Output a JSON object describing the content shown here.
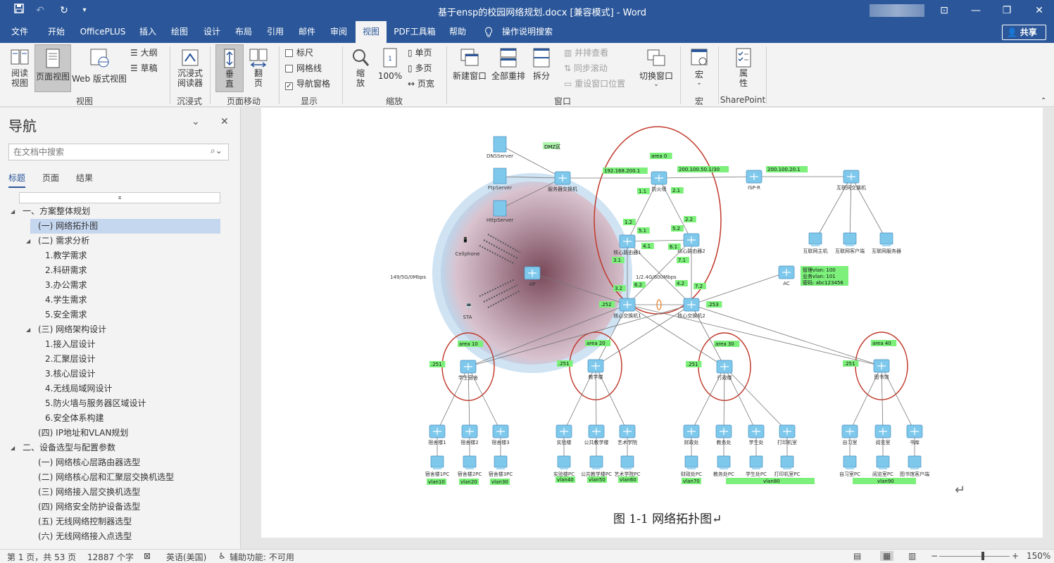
{
  "window": {
    "title": "基于ensp的校园网络规划.docx [兼容模式]  -  Word",
    "controls": {
      "ribbon_display": "⊡",
      "minimize": "—",
      "restore": "❐",
      "close": "✕"
    }
  },
  "quick_access": {
    "save": "💾",
    "undo": "↶",
    "redo": "↻",
    "customize": "▾"
  },
  "menu": {
    "tabs": [
      "文件",
      "开始",
      "OfficePLUS",
      "插入",
      "绘图",
      "设计",
      "布局",
      "引用",
      "邮件",
      "审阅",
      "视图",
      "PDF工具箱",
      "帮助"
    ],
    "active": "视图",
    "tell_me": "操作说明搜索",
    "share": "共享"
  },
  "ribbon": {
    "views": {
      "read": "阅读\n视图",
      "print_layout": "页面视图",
      "web_layout": "Web 版式视图",
      "outline": "大纲",
      "draft": "草稿",
      "group": "视图"
    },
    "immersive": {
      "reader": "沉浸式\n阅读器",
      "group": "沉浸式"
    },
    "page_move": {
      "vertical": "垂\n直",
      "side": "翻\n页",
      "group": "页面移动"
    },
    "show": {
      "ruler": "标尺",
      "gridlines": "网格线",
      "nav_pane": "导航窗格",
      "group": "显示",
      "ruler_checked": false,
      "gridlines_checked": false,
      "nav_checked": true
    },
    "zoom": {
      "zoom": "缩\n放",
      "hundred": "100%",
      "one_page": "单页",
      "multi_page": "多页",
      "page_width": "页宽",
      "group": "缩放"
    },
    "window": {
      "new_window": "新建窗口",
      "arrange_all": "全部重排",
      "split": "拆分",
      "side_by_side": "并排查看",
      "sync_scroll": "同步滚动",
      "reset_pos": "重设窗口位置",
      "switch": "切换窗口",
      "group": "窗口"
    },
    "macros": {
      "macros": "宏",
      "group": "宏"
    },
    "sharepoint": {
      "properties": "属\n性",
      "group": "SharePoint"
    }
  },
  "nav_pane": {
    "title": "导航",
    "search_placeholder": "在文档中搜索",
    "tabs": [
      "标题",
      "页面",
      "结果"
    ],
    "active_tab": "标题",
    "items": [
      {
        "text": "一、方案整体规划",
        "level": 0,
        "expander": true
      },
      {
        "text": "(一)  网络拓扑图",
        "level": 1,
        "selected": true
      },
      {
        "text": "(二)  需求分析",
        "level": 1,
        "expander": true
      },
      {
        "text": "1.教学需求",
        "level": 2
      },
      {
        "text": "2.科研需求",
        "level": 2
      },
      {
        "text": "3.办公需求",
        "level": 2
      },
      {
        "text": "4.学生需求",
        "level": 2
      },
      {
        "text": "5.安全需求",
        "level": 2
      },
      {
        "text": "(三)  网络架构设计",
        "level": 1,
        "expander": true
      },
      {
        "text": "1.接入层设计",
        "level": 2
      },
      {
        "text": "2.汇聚层设计",
        "level": 2
      },
      {
        "text": "3.核心层设计",
        "level": 2
      },
      {
        "text": "4.无线局域网设计",
        "level": 2
      },
      {
        "text": "5.防火墙与服务器区域设计",
        "level": 2
      },
      {
        "text": "6.安全体系构建",
        "level": 2
      },
      {
        "text": "(四)  IP地址和VLAN规划",
        "level": 1
      },
      {
        "text": "二、设备选型与配置参数",
        "level": 0,
        "expander": true
      },
      {
        "text": "(一)  网络核心层路由器选型",
        "level": 1
      },
      {
        "text": "(二)  网络核心层和汇聚层交换机选型",
        "level": 1
      },
      {
        "text": "(三)  网络接入层交换机选型",
        "level": 1
      },
      {
        "text": "(四)  网络安全防护设备选型",
        "level": 1
      },
      {
        "text": "(五)  无线网络控制器选型",
        "level": 1
      },
      {
        "text": "(六)  无线网络接入点选型",
        "level": 1
      }
    ]
  },
  "document": {
    "caption": "图 1-1  网络拓扑图↵",
    "return_mark": "↵",
    "diagram": {
      "servers": [
        "DNSServer",
        "FtpServer",
        "HttpServer"
      ],
      "dmz": "DMZ区",
      "server_switch": "服务器交换机",
      "firewall": "防火墙",
      "isp": "ISP-R",
      "internet_switch": "互联网交换机",
      "internet_hosts": [
        "互联网主机",
        "互联网客户端",
        "互联网服务器"
      ],
      "core_routers": [
        "核心路由器1",
        "核心路由器2"
      ],
      "core_switches": [
        "核心交换机1",
        "核心交换机2"
      ],
      "ac": "AC",
      "ac_info": [
        "管理vlan: 100",
        "业务vlan: 101",
        "密码: abc123456"
      ],
      "wireless": {
        "phone": "Cellphone",
        "ap": "AP",
        "sta": "STA",
        "bw_left": "149/5G/0Mbps",
        "bw_right": "1/2.4G/600Mbps"
      },
      "ip_labels": {
        "fw_in": "192.168.200.1",
        "fw_out": "200.100.50.1/30",
        "isp": "200.100.20.1",
        "area0": "area 0"
      },
      "port_labels": [
        "1.1",
        "2.1",
        "1.2",
        "5.1",
        "5.2",
        "2.2",
        "4.1",
        "6.1",
        "3.1",
        "7.1",
        "3.2",
        "6.2",
        "4.2",
        "7.2",
        ".252",
        ".253"
      ],
      "areas": [
        {
          "name": "area 10",
          "switch": "学生宿舍",
          "ip": ".251",
          "pcs": [
            "宿舍楼1",
            "宿舍楼2",
            "宿舍楼3"
          ],
          "hosts": [
            "宿舍楼1PC",
            "宿舍楼2PC",
            "宿舍楼3PC"
          ],
          "vlans": [
            "vlan10",
            "vlan20",
            "vlan30"
          ]
        },
        {
          "name": "area 20",
          "switch": "教学楼",
          "ip": ".251",
          "pcs": [
            "实验楼",
            "公共教学楼",
            "艺术学院"
          ],
          "hosts": [
            "实验楼PC",
            "公共教学楼PC",
            "艺术学院PC"
          ],
          "vlans": [
            "vlan40",
            "vlan50",
            "vlan60"
          ]
        },
        {
          "name": "area 30",
          "switch": "行政楼",
          "ip": ".251",
          "pcs": [
            "财政处",
            "教务处",
            "学生处",
            "打印机室"
          ],
          "hosts": [
            "财政处PC",
            "教务处PC",
            "学生处PC",
            "打印机室PC"
          ],
          "vlans": [
            "vlan70",
            "vlan80"
          ]
        },
        {
          "name": "area 40",
          "switch": "图书馆",
          "ip": ".251",
          "pcs": [
            "自习室",
            "阅览室",
            "书库"
          ],
          "hosts": [
            "自习室PC",
            "阅览室PC",
            "图书馆客户端"
          ],
          "vlans": [
            "vlan90"
          ]
        }
      ]
    }
  },
  "status": {
    "page": "第 1 页，共 53 页",
    "words": "12887 个字",
    "lang": "英语(美国)",
    "accessibility": "辅助功能: 不可用",
    "zoom_level": "150%",
    "zoom_fraction": 0.62
  },
  "colors": {
    "accent": "#2b579a",
    "ribbon": "#f3f3f3",
    "label_green": "#7cf07a",
    "area_red": "#c0392b",
    "device": "#7ec8ec"
  }
}
